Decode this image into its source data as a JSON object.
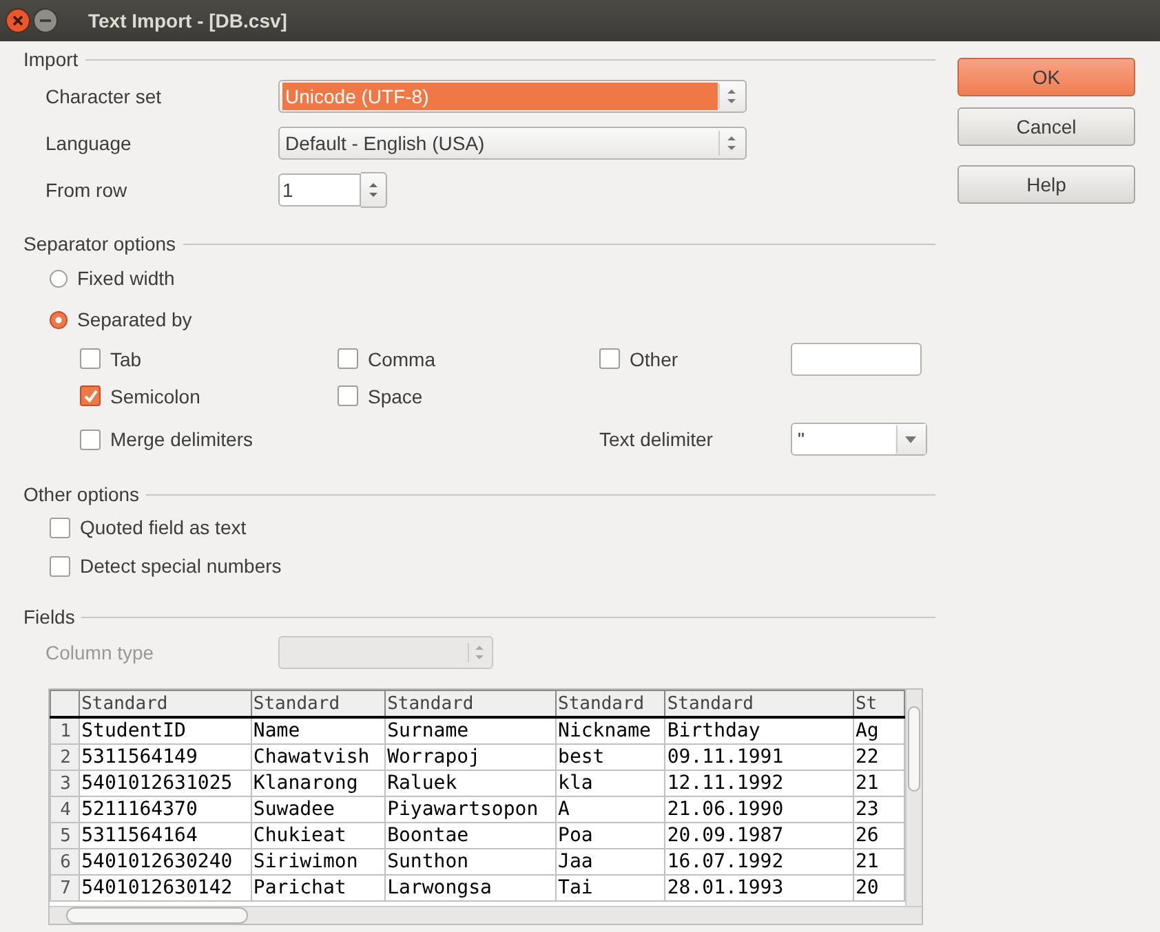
{
  "window": {
    "title": "Text Import - [DB.csv]"
  },
  "import": {
    "heading": "Import",
    "rows": [
      {
        "label": "Character set",
        "kind": "combo",
        "value": "Unicode (UTF-8)",
        "focused": true
      },
      {
        "label": "Language",
        "kind": "combo",
        "value": "Default - English (USA)",
        "focused": false
      },
      {
        "label": "From row",
        "kind": "spin",
        "value": "1"
      }
    ]
  },
  "separator_options": {
    "heading": "Separator options",
    "modes": [
      {
        "label": "Fixed width",
        "selected": false
      },
      {
        "label": "Separated by",
        "selected": true
      }
    ],
    "separators": [
      {
        "label": "Tab",
        "checked": false
      },
      {
        "label": "Comma",
        "checked": false
      },
      {
        "label": "Other",
        "checked": false
      },
      {
        "label": "Semicolon",
        "checked": true
      },
      {
        "label": "Space",
        "checked": false
      },
      {
        "label": "Merge delimiters",
        "checked": false
      }
    ],
    "text_delimiter": {
      "label": "Text delimiter",
      "value": "\""
    }
  },
  "other_options": {
    "heading": "Other options",
    "options": [
      {
        "label": "Quoted field as text",
        "checked": false
      },
      {
        "label": "Detect special numbers",
        "checked": false
      }
    ]
  },
  "fields": {
    "heading": "Fields",
    "column_type": {
      "label": "Column type",
      "disabled": true
    },
    "table": {
      "columns": [
        "Standard",
        "Standard",
        "Standard",
        "Standard",
        "Standard",
        "St"
      ],
      "rows": [
        {
          "number": "1",
          "cells": [
            "StudentID",
            "Name",
            "Surname",
            "Nickname",
            "Birthday",
            "Ag"
          ]
        },
        {
          "number": "2",
          "cells": [
            "5311564149",
            "Chawatvish",
            "Worrapoj",
            "best",
            "09.11.1991",
            "22"
          ]
        },
        {
          "number": "3",
          "cells": [
            "5401012631025",
            "Klanarong",
            "Raluek",
            "kla",
            "12.11.1992",
            "21"
          ]
        },
        {
          "number": "4",
          "cells": [
            "5211164370",
            "Suwadee",
            "Piyawartsopon",
            "A",
            "21.06.1990",
            "23"
          ]
        },
        {
          "number": "5",
          "cells": [
            "5311564164",
            "Chukieat",
            "Boontae",
            "Poa",
            "20.09.1987",
            "26"
          ]
        },
        {
          "number": "6",
          "cells": [
            "5401012630240",
            "Siriwimon",
            "Sunthon",
            "Jaa",
            "16.07.1992",
            "21"
          ]
        },
        {
          "number": "7",
          "cells": [
            "5401012630142",
            "Parichat",
            "Larwongsa",
            "Tai",
            "28.01.1993",
            "20"
          ]
        }
      ]
    }
  },
  "buttons": [
    {
      "label": "OK",
      "default": true
    },
    {
      "label": "Cancel",
      "default": false
    },
    {
      "label": "Help",
      "default": false
    }
  ]
}
